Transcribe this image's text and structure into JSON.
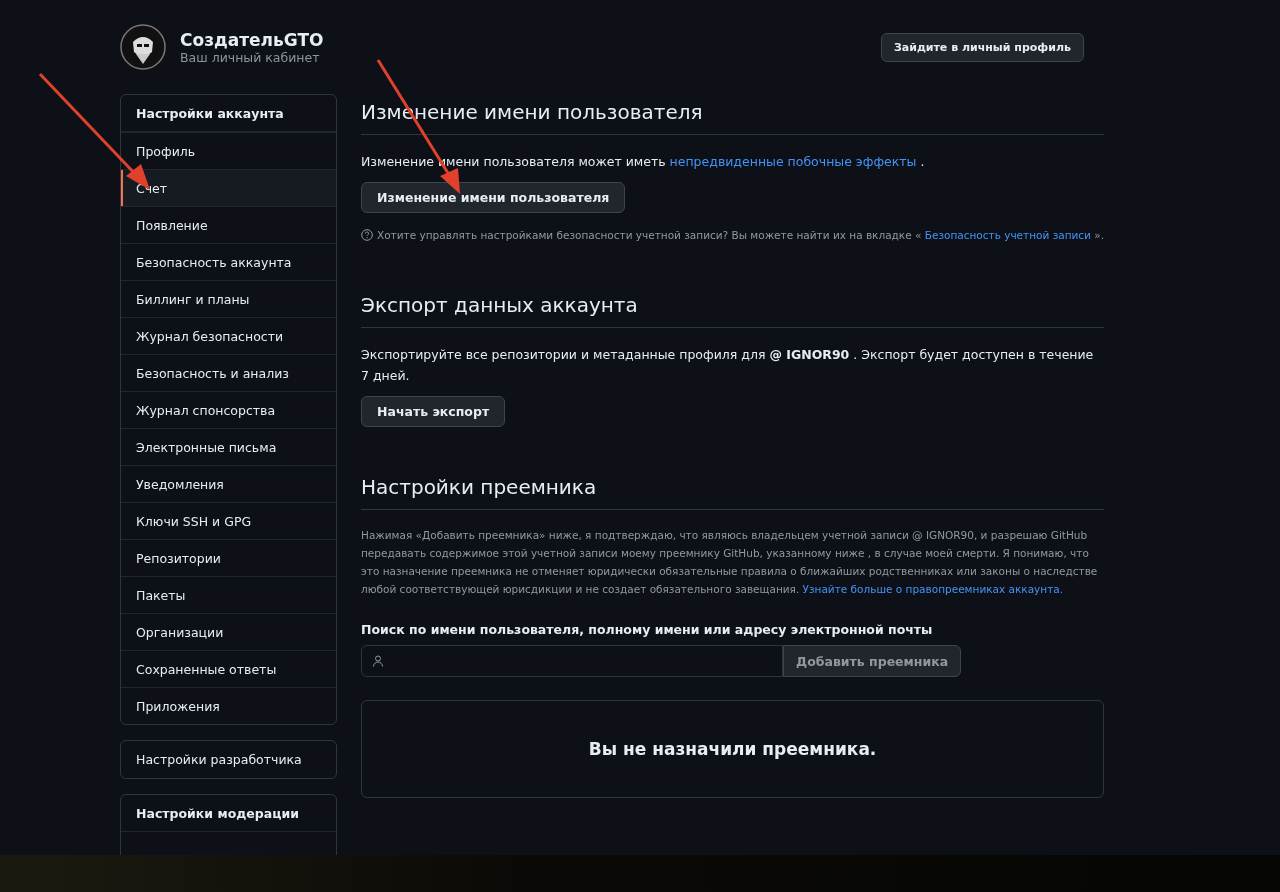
{
  "header": {
    "name": "СоздательGTO",
    "subtitle": "Ваш личный кабинет",
    "profile_button": "Зайдите в личный профиль"
  },
  "sidebar": {
    "groups": [
      {
        "title": "Настройки аккаунта",
        "items": [
          {
            "label": "Профиль",
            "selected": false
          },
          {
            "label": "Счет",
            "selected": true
          },
          {
            "label": "Появление",
            "selected": false
          },
          {
            "label": "Безопасность аккаунта",
            "selected": false
          },
          {
            "label": "Биллинг и планы",
            "selected": false
          },
          {
            "label": "Журнал безопасности",
            "selected": false
          },
          {
            "label": "Безопасность и анализ",
            "selected": false
          },
          {
            "label": "Журнал спонсорства",
            "selected": false
          },
          {
            "label": "Электронные письма",
            "selected": false
          },
          {
            "label": "Уведомления",
            "selected": false
          },
          {
            "label": "Ключи SSH и GPG",
            "selected": false
          },
          {
            "label": "Репозитории",
            "selected": false
          },
          {
            "label": "Пакеты",
            "selected": false
          },
          {
            "label": "Организации",
            "selected": false
          },
          {
            "label": "Сохраненные ответы",
            "selected": false
          },
          {
            "label": "Приложения",
            "selected": false
          }
        ]
      },
      {
        "items": [
          {
            "label": "Настройки разработчика",
            "selected": false
          }
        ]
      },
      {
        "title": "Настройки модерации"
      }
    ]
  },
  "sections": [
    {
      "title": "Изменение имени пользователя",
      "text": "Изменение имени пользователя может иметь",
      "link": "непредвиденные побочные эффекты",
      "after": ".",
      "button": "Изменение имени пользователя",
      "note": "Хотите управлять настройками безопасности учетной записи? Вы можете найти их на вкладке «",
      "note_link": "Безопасность учетной записи",
      "note_after": "»."
    },
    {
      "title": "Экспорт данных аккаунта",
      "text": "Экспортируйте все репозитории и метаданные профиля для **@ IGNOR90** . Экспорт будет доступен в течение 7 дней.",
      "button": "Начать экспорт"
    },
    {
      "title": "Настройки преемника",
      "text": "Нажимая «Добавить преемника» ниже, я подтверждаю, что являюсь владельцем учетной записи @ IGNOR90, и разрешаю GitHub передавать содержимое этой учетной записи моему преемнику GitHub, указанному ниже , в случае моей смерти. Я понимаю, что это назначение преемника не отменяет юридически обязательные правила о ближайших родственниках или законы о наследстве любой соответствующей юрисдикции и не создает обязательного завещания.",
      "link": "Узнайте больше о правопреемниках аккаунта.",
      "search_label": "Поиск по имени пользователя, полному имени или адресу электронной почты",
      "add_button": "Добавить преемника",
      "empty": "Вы не назначили преемника."
    }
  ]
}
